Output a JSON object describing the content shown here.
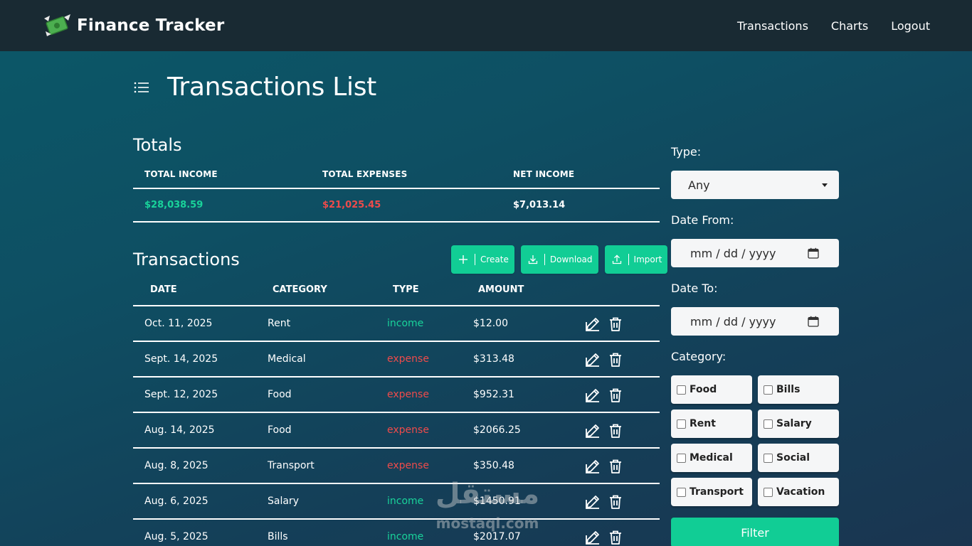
{
  "navbar": {
    "brand": "Finance Tracker",
    "brand_icon": "money-wings-icon",
    "links": [
      "Transactions",
      "Charts",
      "Logout"
    ]
  },
  "page": {
    "title": "Transactions List",
    "icon": "list-icon"
  },
  "totals": {
    "title": "Totals",
    "headers": [
      "TOTAL INCOME",
      "TOTAL EXPENSES",
      "NET INCOME"
    ],
    "income": "$28,038.59",
    "expenses": "$21,025.45",
    "net": "$7,013.14"
  },
  "transactions": {
    "title": "Transactions",
    "buttons": {
      "create": "Create",
      "download": "Download",
      "import": "Import"
    },
    "headers": [
      "DATE",
      "CATEGORY",
      "TYPE",
      "AMOUNT"
    ],
    "rows": [
      {
        "date": "Oct. 11, 2025",
        "category": "Rent",
        "type": "income",
        "amount": "$12.00"
      },
      {
        "date": "Sept. 14, 2025",
        "category": "Medical",
        "type": "expense",
        "amount": "$313.48"
      },
      {
        "date": "Sept. 12, 2025",
        "category": "Food",
        "type": "expense",
        "amount": "$952.31"
      },
      {
        "date": "Aug. 14, 2025",
        "category": "Food",
        "type": "expense",
        "amount": "$2066.25"
      },
      {
        "date": "Aug. 8, 2025",
        "category": "Transport",
        "type": "expense",
        "amount": "$350.48"
      },
      {
        "date": "Aug. 6, 2025",
        "category": "Salary",
        "type": "income",
        "amount": "$1450.91"
      },
      {
        "date": "Aug. 5, 2025",
        "category": "Bills",
        "type": "income",
        "amount": "$2017.07"
      }
    ]
  },
  "filters": {
    "type_label": "Type:",
    "type_value": "Any",
    "date_from_label": "Date From:",
    "date_to_label": "Date To:",
    "date_placeholder": "mm / dd / yyyy",
    "category_label": "Category:",
    "categories": [
      "Food",
      "Bills",
      "Rent",
      "Salary",
      "Medical",
      "Social",
      "Transport",
      "Vacation"
    ],
    "filter_button": "Filter"
  },
  "watermark": {
    "arabic": "مستقل",
    "latin": "mostaql.com"
  },
  "colors": {
    "accent": "#11cd95",
    "income": "#19d39a",
    "expense": "#ef4b4b",
    "navbar": "#192a33"
  }
}
